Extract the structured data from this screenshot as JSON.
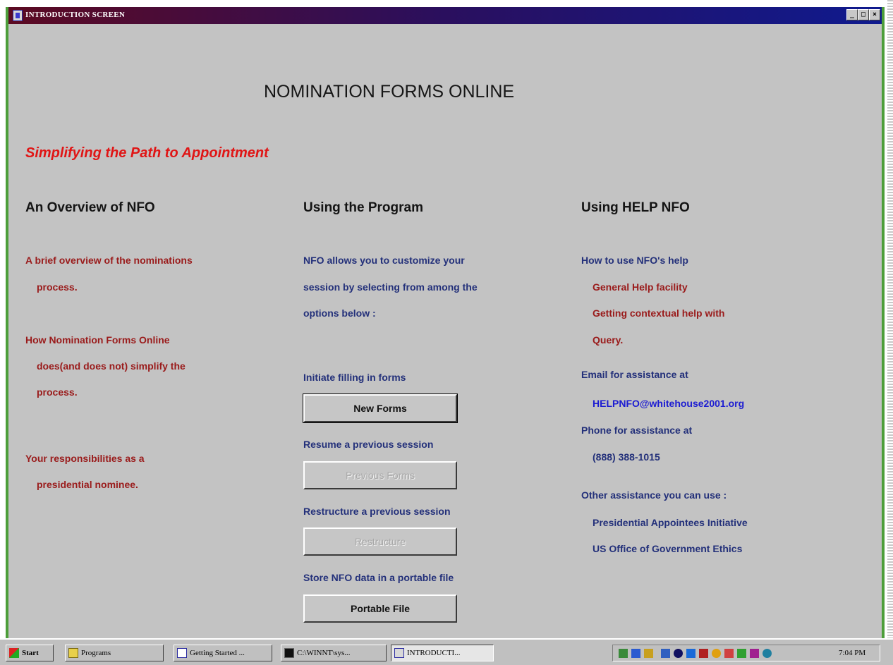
{
  "window": {
    "title": "INTRODUCTION SCREEN",
    "controls": [
      "_",
      "□",
      "×"
    ]
  },
  "main": {
    "title": "NOMINATION FORMS ONLINE",
    "subtitle": "Simplifying the Path to Appointment"
  },
  "overview": {
    "heading": "An Overview of NFO",
    "links": [
      [
        "A brief overview of the nominations",
        "process."
      ],
      [
        "How Nomination Forms Online",
        "does(and does not) simplify the",
        "process."
      ],
      [
        "Your responsibilities as a",
        "presidential nominee."
      ]
    ]
  },
  "program": {
    "heading": "Using the Program",
    "intro": [
      "NFO allows you to customize your",
      "session by selecting from among the",
      "options below :"
    ],
    "sections": [
      {
        "label": "Initiate filling in forms",
        "button": "New Forms",
        "enabled": true
      },
      {
        "label": "Resume a previous session",
        "button": "Previous Forms",
        "enabled": false
      },
      {
        "label": "Restructure a previous session",
        "button": "Restructure",
        "enabled": false
      },
      {
        "label": "Store NFO data in a portable file",
        "button": "Portable File",
        "enabled": true
      }
    ]
  },
  "help": {
    "heading": "Using HELP NFO",
    "how_to": "How to use NFO's help",
    "help_links": [
      "General Help facility",
      "Getting contextual help with",
      "Query."
    ],
    "email_label": "Email for assistance at",
    "email": "HELPNFO@whitehouse2001.org",
    "phone_label": "Phone for assistance at",
    "phone": "(888) 388-1015",
    "other_label": "Other assistance you can use :",
    "other_links": [
      "Presidential Appointees Initiative",
      "US Office of Government Ethics"
    ]
  },
  "taskbar": {
    "start": "Start",
    "tasks": [
      "Programs",
      "Getting Started ...",
      "C:\\WINNT\\sys...",
      "INTRODUCTI..."
    ],
    "clock": "7:04 PM"
  },
  "colors": {
    "titlebar_start": "#5c0a22",
    "titlebar_end": "#0f1a8e",
    "window_bg": "#c3c3c3",
    "accent_red": "#e01515",
    "link_red": "#9a1b1b",
    "text_blue": "#23307a",
    "link_blue": "#1c1cd2"
  }
}
